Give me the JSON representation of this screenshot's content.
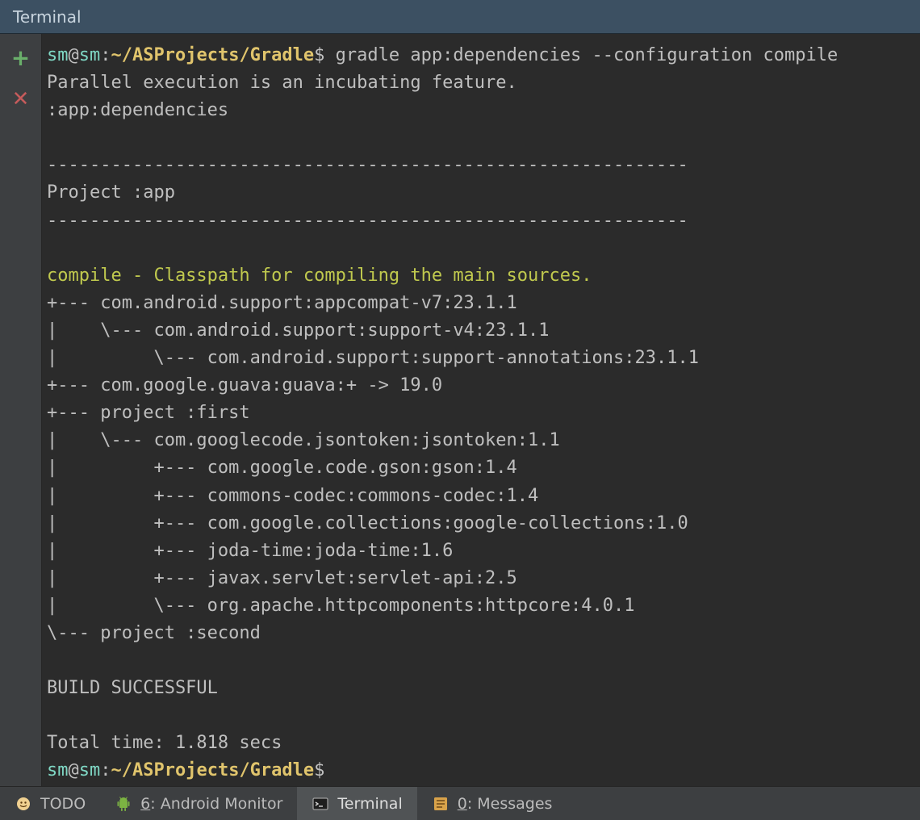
{
  "titlebar": {
    "title": "Terminal"
  },
  "gutter": {
    "add_label": "+",
    "close_label": "✕"
  },
  "prompt": {
    "user": "sm",
    "at": "@",
    "host": "sm",
    "sep": ":",
    "path": "~/ASProjects/Gradle",
    "dollar": "$"
  },
  "terminal": {
    "command": " gradle app:dependencies --configuration compile",
    "lines": {
      "l0": "Parallel execution is an incubating feature.",
      "l1": ":app:dependencies",
      "l2": "",
      "l3": "------------------------------------------------------------",
      "l4": "Project :app",
      "l5": "------------------------------------------------------------",
      "l6": "",
      "l7": "compile - Classpath for compiling the main sources.",
      "l8": "+--- com.android.support:appcompat-v7:23.1.1",
      "l9": "|    \\--- com.android.support:support-v4:23.1.1",
      "l10": "|         \\--- com.android.support:support-annotations:23.1.1",
      "l11": "+--- com.google.guava:guava:+ -> 19.0",
      "l12": "+--- project :first",
      "l13": "|    \\--- com.googlecode.jsontoken:jsontoken:1.1",
      "l14": "|         +--- com.google.code.gson:gson:1.4",
      "l15": "|         +--- commons-codec:commons-codec:1.4",
      "l16": "|         +--- com.google.collections:google-collections:1.0",
      "l17": "|         +--- joda-time:joda-time:1.6",
      "l18": "|         +--- javax.servlet:servlet-api:2.5",
      "l19": "|         \\--- org.apache.httpcomponents:httpcore:4.0.1",
      "l20": "\\--- project :second",
      "l21": "",
      "l22": "BUILD SUCCESSFUL",
      "l23": "",
      "l24": "Total time: 1.818 secs"
    }
  },
  "toolbar": {
    "todo": {
      "label": "TODO"
    },
    "android_monitor": {
      "accel": "6",
      "rest": ": Android Monitor"
    },
    "terminal": {
      "label": "Terminal"
    },
    "messages": {
      "accel": "0",
      "rest": ": Messages"
    }
  }
}
